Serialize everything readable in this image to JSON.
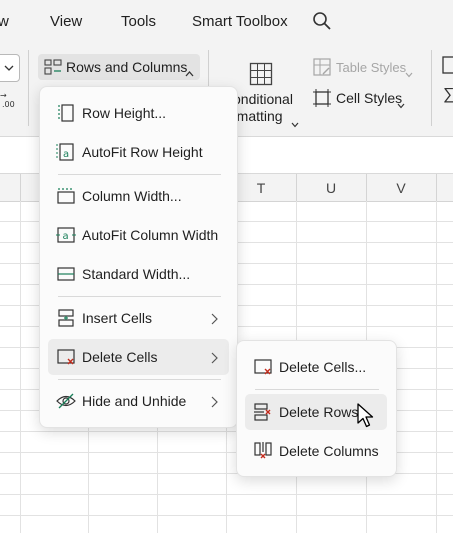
{
  "menubar": {
    "items": [
      "w",
      "View",
      "Tools",
      "Smart Toolbox"
    ]
  },
  "ribbon": {
    "rows_columns_label": "Rows and  Columns",
    "conditional_line1": "onditional",
    "conditional_line2": "rmatting",
    "table_styles_label": "Table Styles",
    "cell_styles_label": "Cell Styles"
  },
  "columns": [
    "T",
    "U",
    "V"
  ],
  "main_menu": {
    "items": [
      {
        "label": "Row Height..."
      },
      {
        "label": "AutoFit Row Height"
      },
      {
        "label": "Column Width..."
      },
      {
        "label": "AutoFit Column Width"
      },
      {
        "label": "Standard Width..."
      },
      {
        "label": "Insert Cells"
      },
      {
        "label": "Delete Cells"
      },
      {
        "label": "Hide and Unhide"
      }
    ]
  },
  "submenu": {
    "items": [
      {
        "label": "Delete Cells..."
      },
      {
        "label": "Delete Rows"
      },
      {
        "label": "Delete Columns"
      }
    ]
  },
  "colors": {
    "accent_red": "#c42b1c",
    "accent_teal": "#1a7f5a",
    "highlight": "#ececec"
  }
}
